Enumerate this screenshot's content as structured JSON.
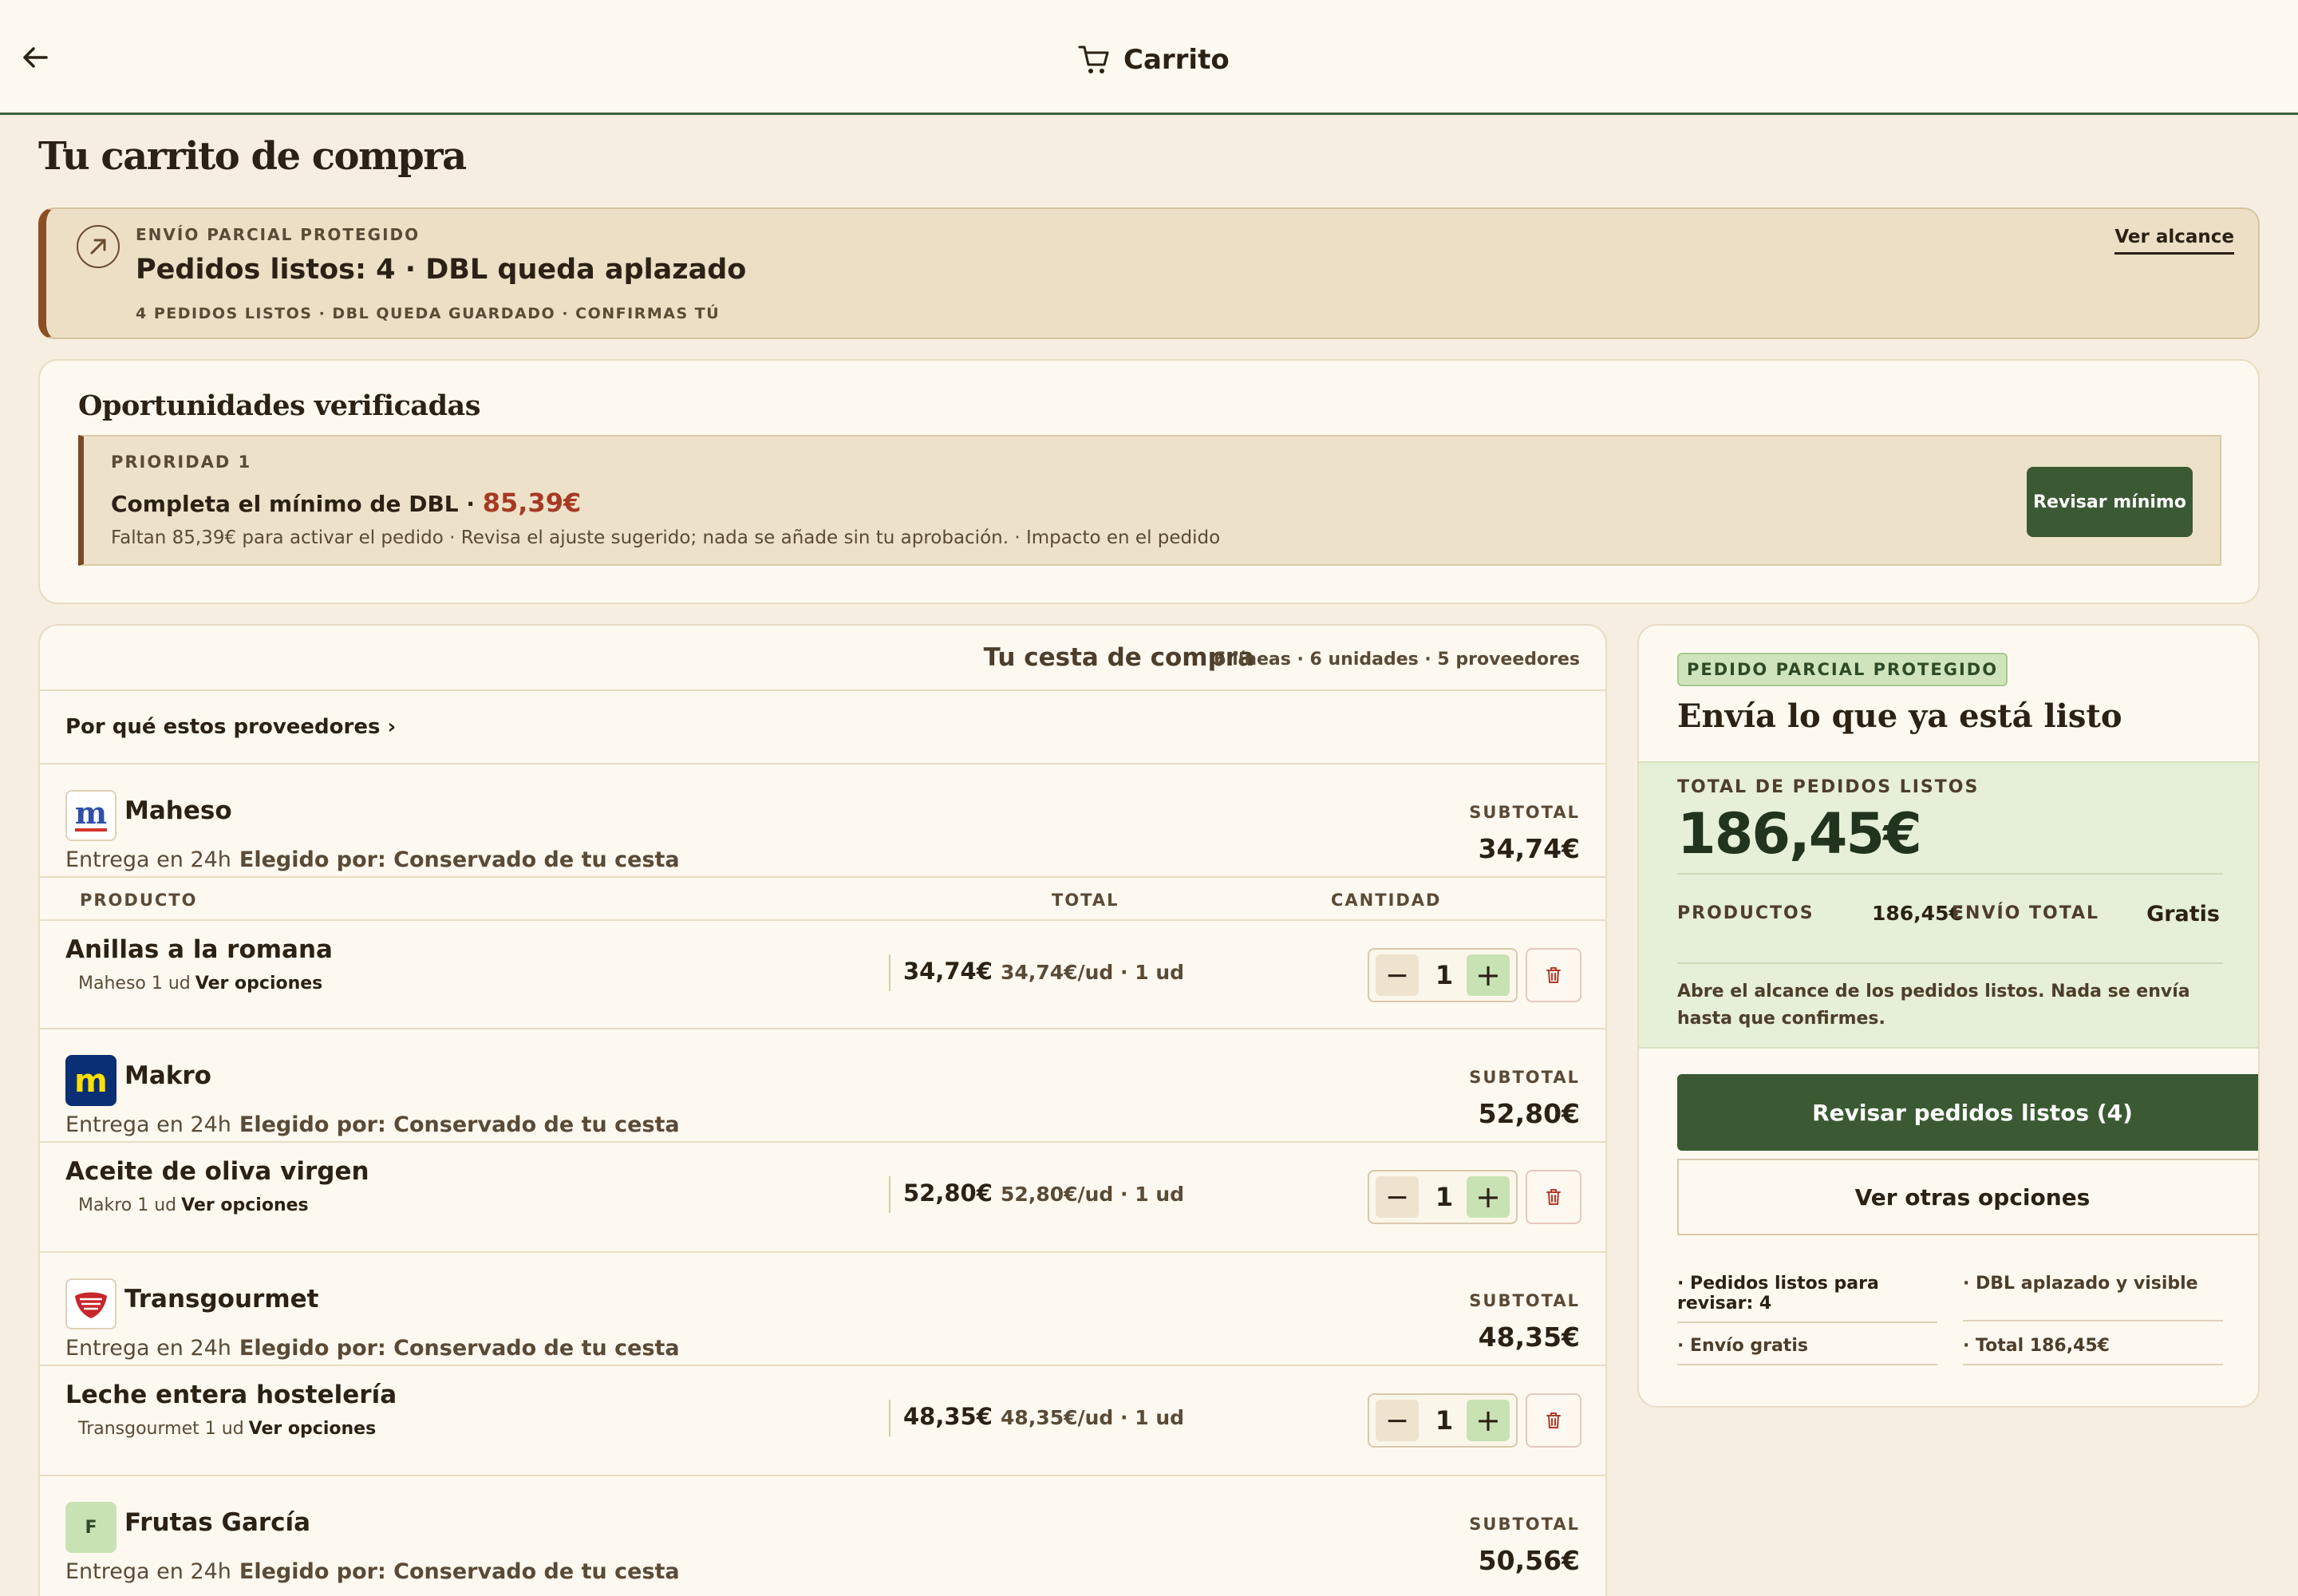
{
  "header": {
    "title": "Carrito",
    "back_icon": "arrow-left-icon",
    "cart_icon": "cart-icon"
  },
  "page_title": "Tu carrito de compra",
  "banner": {
    "kicker": "ENVÍO PARCIAL PROTEGIDO",
    "headline": "Pedidos listos: 4 · DBL queda aplazado",
    "sub": "4 PEDIDOS LISTOS · DBL QUEDA GUARDADO · CONFIRMAS TÚ",
    "link": "Ver alcance",
    "accent": "#8a4e24"
  },
  "opportunities": {
    "title": "Oportunidades verificadas",
    "card": {
      "priority": "PRIORIDAD 1",
      "headline": "Completa el mínimo de DBL ·",
      "amount": "85,39€",
      "detail": "Faltan 85,39€ para activar el pedido · Revisa el ajuste sugerido; nada se añade sin tu aprobación. · Impacto en el pedido",
      "button": "Revisar mínimo"
    }
  },
  "cart": {
    "title": "Tu cesta de compra",
    "meta": "6 líneas · 6 unidades · 5 proveedores",
    "why_link": "Por qué estos proveedores ›",
    "columns": {
      "product": "PRODUCTO",
      "total": "TOTAL",
      "quantity": "CANTIDAD"
    },
    "subtotal_label": "SUBTOTAL",
    "delivery": "Entrega en 24h",
    "chosen_by": "Elegido por: Conservado de tu cesta",
    "vendors": [
      {
        "name": "Maheso",
        "subtotal": "34,74€",
        "logo_letter": "m"
      },
      {
        "name": "Makro",
        "subtotal": "52,80€",
        "logo_letter": "m"
      },
      {
        "name": "Transgourmet",
        "subtotal": "48,35€",
        "logo_letter": ""
      },
      {
        "name": "Frutas García",
        "subtotal": "50,56€",
        "logo_letter": "F"
      }
    ],
    "items": [
      {
        "name": "Anillas a la romana",
        "vendor": "Maheso",
        "unit_qty": "1 ud",
        "options": "Ver opciones",
        "total": "34,74€",
        "unit_price": "34,74€/ud · 1 ud",
        "qty": "1"
      },
      {
        "name": "Aceite de oliva virgen",
        "vendor": "Makro",
        "unit_qty": "1 ud",
        "options": "Ver opciones",
        "total": "52,80€",
        "unit_price": "52,80€/ud · 1 ud",
        "qty": "1"
      },
      {
        "name": "Leche entera hostelería",
        "vendor": "Transgourmet",
        "unit_qty": "1 ud",
        "options": "Ver opciones",
        "total": "48,35€",
        "unit_price": "48,35€/ud · 1 ud",
        "qty": "1"
      }
    ]
  },
  "summary": {
    "badge": "PEDIDO PARCIAL PROTEGIDO",
    "headline": "Envía lo que ya está listo",
    "total_label": "TOTAL DE PEDIDOS LISTOS",
    "total": "186,45€",
    "products_label": "PRODUCTOS",
    "products_value": "186,45€",
    "shipping_label": "ENVÍO TOTAL",
    "shipping_value": "Gratis",
    "note": "Abre el alcance de los pedidos listos. Nada se envía hasta que confirmes.",
    "primary_button": "Revisar pedidos listos (4)",
    "secondary_button": "Ver otras opciones",
    "facts": [
      "· Pedidos listos para revisar: 4",
      "· DBL aplazado y visible",
      "· Envío gratis",
      "· Total 186,45€"
    ]
  }
}
